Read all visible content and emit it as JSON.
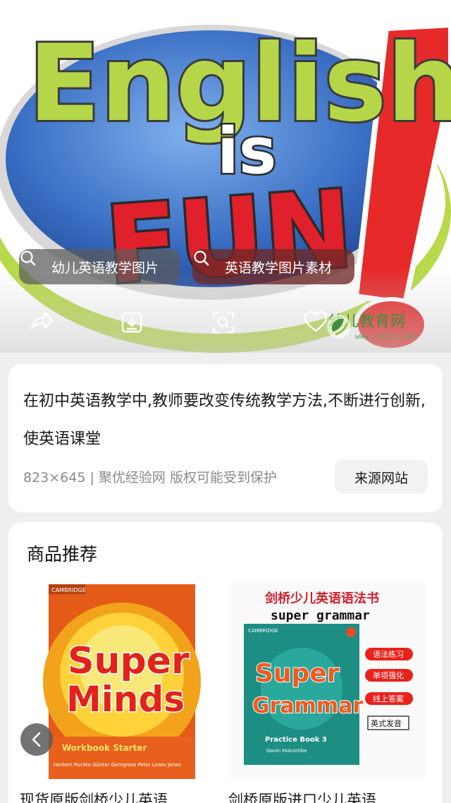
{
  "hero": {
    "image_words": [
      "English",
      "is",
      "FUN"
    ],
    "search_chips": [
      {
        "label": "幼儿英语教学图片",
        "icon": "search-icon"
      },
      {
        "label": "英语教学图片素材",
        "icon": "search-icon"
      }
    ],
    "actions": [
      "share-icon",
      "download-icon",
      "visual-search-icon",
      "heart-icon"
    ],
    "watermark": {
      "name": "幼儿教育网",
      "url": "www.jy135.com"
    }
  },
  "info": {
    "description": "在初中英语教学中,教师要改变传统教学方法,不断进行创新,使英语课堂",
    "meta": "823×645 | 聚优经验网 版权可能受到保护",
    "source_button": "来源网站"
  },
  "products": {
    "title": "商品推荐",
    "items": [
      {
        "title": "现货原版剑桥少儿英语",
        "cover": {
          "publisher": "CAMBRIDGE",
          "line1": "Super",
          "line2": "Minds",
          "subtitle": "Workbook Starter",
          "authors": "Herbert Puchta   Günter Gerngross   Peter Lewis-Jones"
        }
      },
      {
        "title": "剑桥原版进口少儿英语",
        "cover": {
          "heading_cn": "剑桥少儿英语语法书",
          "heading_en": "super grammar",
          "publisher": "CAMBRIDGE",
          "line1": "Super",
          "line2": "Grammar",
          "subtitle": "Practice Book 3",
          "author": "Gavin Holcombe",
          "tags": [
            "语法练习",
            "单项强化",
            "线上答案",
            "英式发音"
          ]
        }
      }
    ]
  },
  "colors": {
    "lime": "#b6d64a",
    "red": "#e0202a",
    "blue": "#3a6fc4",
    "accent_green": "#3f8f3a"
  }
}
